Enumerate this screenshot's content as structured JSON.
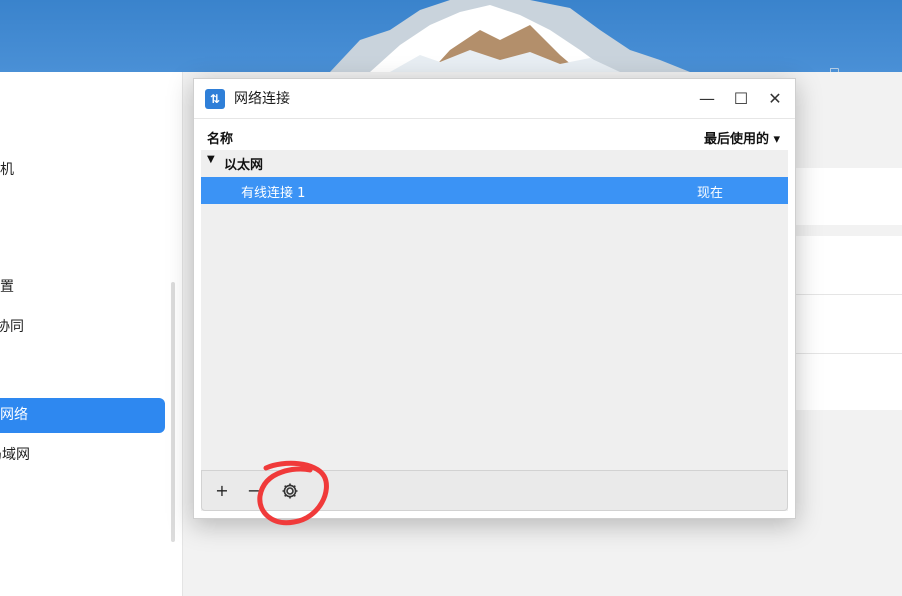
{
  "background_window": {
    "sidebar_items": [
      "机",
      "置",
      "协同",
      "网络",
      "局域网"
    ],
    "active_item": "网络"
  },
  "dialog": {
    "title": "网络连接",
    "app_icon": "network-transfer-icon",
    "window_controls": {
      "minimize": "—",
      "maximize": "☐",
      "close": "✕"
    },
    "table": {
      "column_name": "名称",
      "column_last_used": "最后使用的 ▾",
      "groups": [
        {
          "label": "以太网",
          "expanded_symbol": "▼",
          "connections": [
            {
              "name": "有线连接 1",
              "last_used": "现在",
              "selected": true
            }
          ]
        }
      ]
    },
    "toolbar": {
      "add": "+",
      "remove": "−",
      "settings_icon": "gear-icon"
    }
  },
  "colors": {
    "selection": "#3b93f5",
    "accent": "#2e88f0",
    "annotation": "#f03a3a"
  }
}
